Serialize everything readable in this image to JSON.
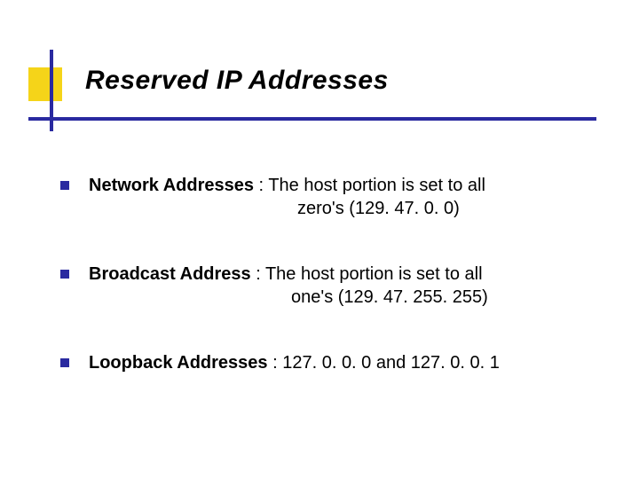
{
  "title": "Reserved IP Addresses",
  "items": [
    {
      "term": "Network Addresses",
      "sep": " : ",
      "line1": "The host portion is set to all",
      "line2": "zero's (129. 47. 0. 0)"
    },
    {
      "term": "Broadcast Address",
      "sep": " :  ",
      "line1": "The host portion is set to all",
      "line2": "one's (129. 47. 255. 255)"
    },
    {
      "term": "Loopback Addresses",
      "sep": " : ",
      "line1": "127. 0. 0. 0 and 127. 0. 0. 1",
      "line2": ""
    }
  ]
}
